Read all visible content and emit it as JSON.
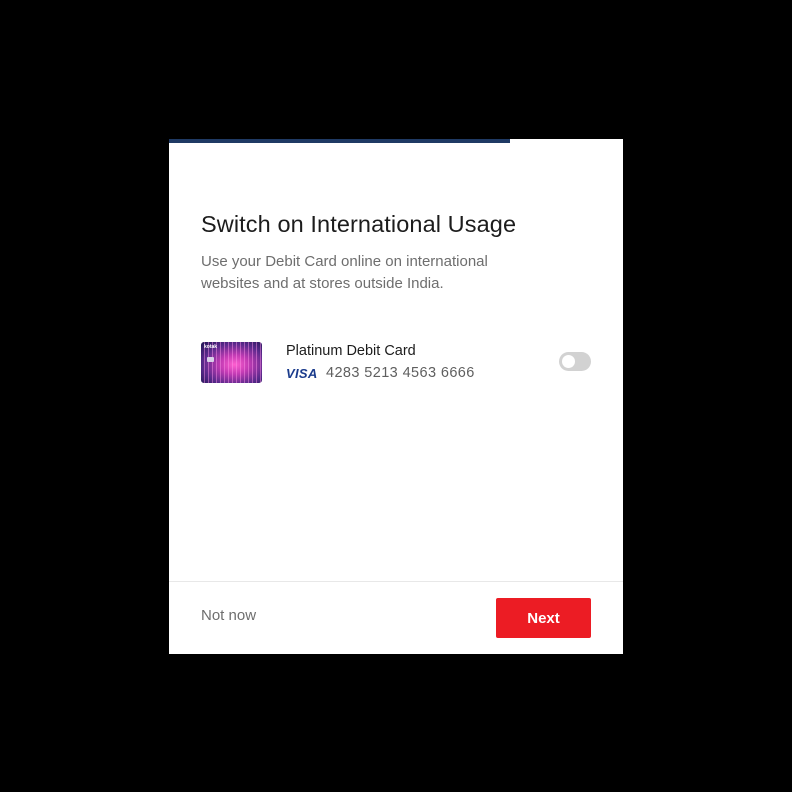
{
  "dialog": {
    "progress_fraction": 0.75,
    "progress_color": "#1f3a64",
    "title": "Switch on International Usage",
    "subtitle": "Use your Debit Card online on international websites and at stores outside India."
  },
  "card": {
    "thumbnail_brand": "kotak",
    "name": "Platinum Debit Card",
    "network": "VISA",
    "number": "4283 5213 4563 6666",
    "international_enabled": false
  },
  "footer": {
    "secondary_label": "Not now",
    "primary_label": "Next",
    "primary_color": "#ec1c24"
  }
}
